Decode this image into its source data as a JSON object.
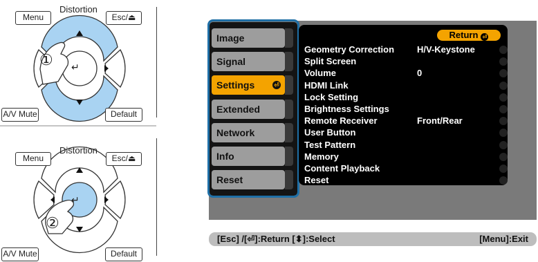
{
  "remotes": [
    {
      "step": "①",
      "labels": {
        "menu": "Menu",
        "distortion": "Distortion",
        "esc": "Esc/⏏",
        "av_mute": "A/V Mute",
        "default": "Default"
      },
      "highlight": "up-down",
      "highlight_color": "#a9d3f2"
    },
    {
      "step": "②",
      "labels": {
        "menu": "Menu",
        "distortion": "Distortion",
        "esc": "Esc/⏏",
        "av_mute": "A/V Mute",
        "default": "Default"
      },
      "highlight": "enter",
      "highlight_color": "#a9d3f2"
    }
  ],
  "menu": {
    "tabs": [
      {
        "label": "Image",
        "active": false
      },
      {
        "label": "Signal",
        "active": false
      },
      {
        "label": "Settings",
        "active": true
      },
      {
        "label": "Extended",
        "active": false
      },
      {
        "label": "Network",
        "active": false
      },
      {
        "label": "Info",
        "active": false
      },
      {
        "label": "Reset",
        "active": false
      }
    ],
    "return_label": "Return",
    "items": [
      {
        "label": "Geometry Correction",
        "value": "H/V-Keystone"
      },
      {
        "label": "Split Screen",
        "value": ""
      },
      {
        "label": "Volume",
        "value": "0"
      },
      {
        "label": "HDMI Link",
        "value": ""
      },
      {
        "label": "Lock Setting",
        "value": ""
      },
      {
        "label": "Brightness Settings",
        "value": ""
      },
      {
        "label": "Remote Receiver",
        "value": "Front/Rear"
      },
      {
        "label": "User Button",
        "value": ""
      },
      {
        "label": "Test Pattern",
        "value": ""
      },
      {
        "label": "Memory",
        "value": ""
      },
      {
        "label": "Content Playback",
        "value": ""
      },
      {
        "label": "Reset",
        "value": ""
      }
    ]
  },
  "statusbar": {
    "left": "[Esc] /[⏎]:Return  [⬍]:Select",
    "right": "[Menu]:Exit"
  },
  "colors": {
    "active_tab": "#f4a300",
    "frame": "#1f6fa6",
    "screen": "#7a7a7a"
  }
}
